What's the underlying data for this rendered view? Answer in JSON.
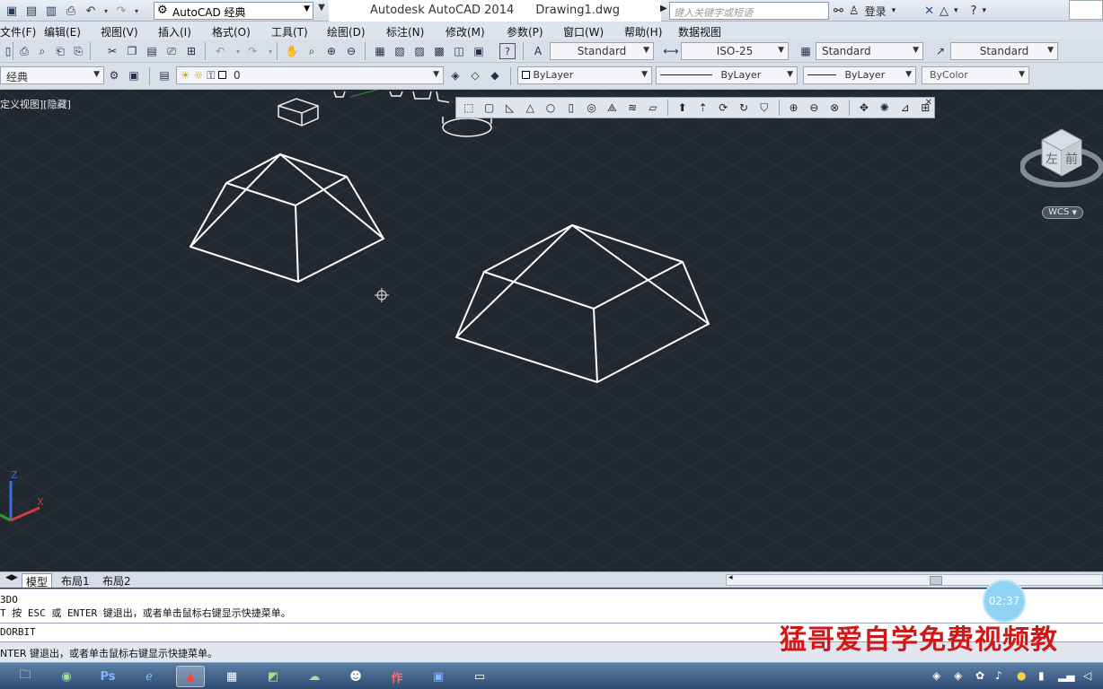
{
  "titlebar": {
    "workspace": "AutoCAD 经典",
    "app_name": "Autodesk AutoCAD 2014",
    "document": "Drawing1.dwg",
    "search_placeholder": "键入关键字或短语",
    "login_label": "登录"
  },
  "menu": {
    "items": [
      "文件(F)",
      "编辑(E)",
      "视图(V)",
      "插入(I)",
      "格式(O)",
      "工具(T)",
      "绘图(D)",
      "标注(N)",
      "修改(M)",
      "参数(P)",
      "窗口(W)",
      "帮助(H)",
      "数据视图"
    ]
  },
  "styles": {
    "text_style": "Standard",
    "dim_style": "ISO-25",
    "table_style": "Standard",
    "multileader_style": "Standard"
  },
  "layers": {
    "workspace": "经典",
    "current_layer": "0",
    "color": "ByLayer",
    "linetype": "ByLayer",
    "lineweight": "ByLayer",
    "plotstyle": "ByColor"
  },
  "viewport": {
    "label": "定义视图][隐藏]",
    "wcs_label": "WCS",
    "viewcube_left": "左",
    "viewcube_front": "前"
  },
  "tabs": {
    "model": "模型",
    "layout1": "布局1",
    "layout2": "布局2"
  },
  "command": {
    "history_line1": "3DO",
    "history_line2": "T 按 ESC 或 ENTER 键退出，或者单击鼠标右键显示快捷菜单。",
    "current": "DORBIT",
    "status": "NTER 键退出，或者单击鼠标右键显示快捷菜单。"
  },
  "overlay": {
    "timer": "02:37",
    "watermark": "猛哥爱自学免费视频教"
  },
  "colors": {
    "viewport_bg": "#212830",
    "watermark": "#d01818",
    "timer_bg": "#8fd2f4"
  }
}
